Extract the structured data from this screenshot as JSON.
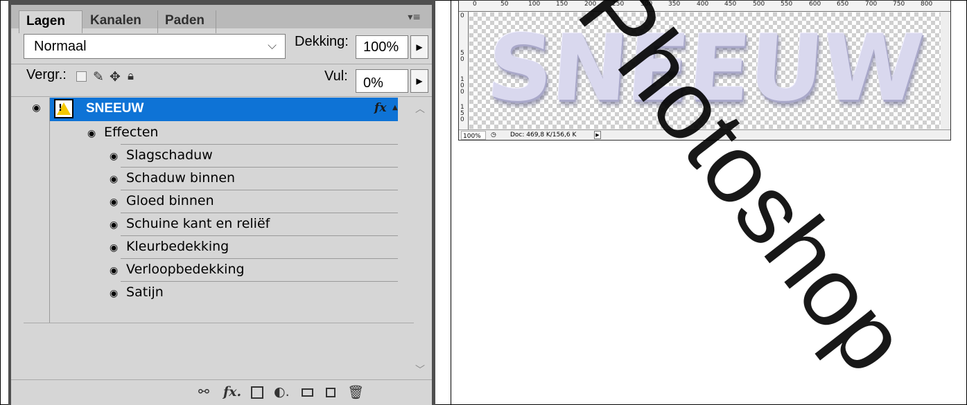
{
  "panel": {
    "tabs": [
      {
        "label": "Lagen",
        "active": true
      },
      {
        "label": "Kanalen",
        "active": false
      },
      {
        "label": "Paden",
        "active": false
      }
    ],
    "menu_icon": "panel-menu-icon"
  },
  "blend": {
    "value": "Normaal",
    "chevron": "⌵"
  },
  "opacity": {
    "label": "Dekking:",
    "value": "100%"
  },
  "fill": {
    "label": "Vul:",
    "value": "0%"
  },
  "lock": {
    "label": "Vergr.:"
  },
  "layer": {
    "name": "SNEEUW",
    "fx": "fx"
  },
  "effects": {
    "header": "Effecten",
    "items": [
      "Slagschaduw",
      "Schaduw binnen",
      "Gloed binnen",
      "Schuine kant en reliëf",
      "Kleurbedekking",
      "Verloopbedekking",
      "Satijn"
    ]
  },
  "doc": {
    "ruler_ticks": [
      "0",
      "50",
      "100",
      "150",
      "200",
      "250",
      "300",
      "350",
      "400",
      "450",
      "500",
      "550",
      "600",
      "650",
      "700",
      "750",
      "800"
    ],
    "vruler_ticks": [
      "0",
      "50",
      "100",
      "150"
    ],
    "canvas_text": "SNEEUW",
    "zoom": "100%",
    "info": "Doc: 469,8 K/156,6 K"
  },
  "watermark": "Photoshop"
}
